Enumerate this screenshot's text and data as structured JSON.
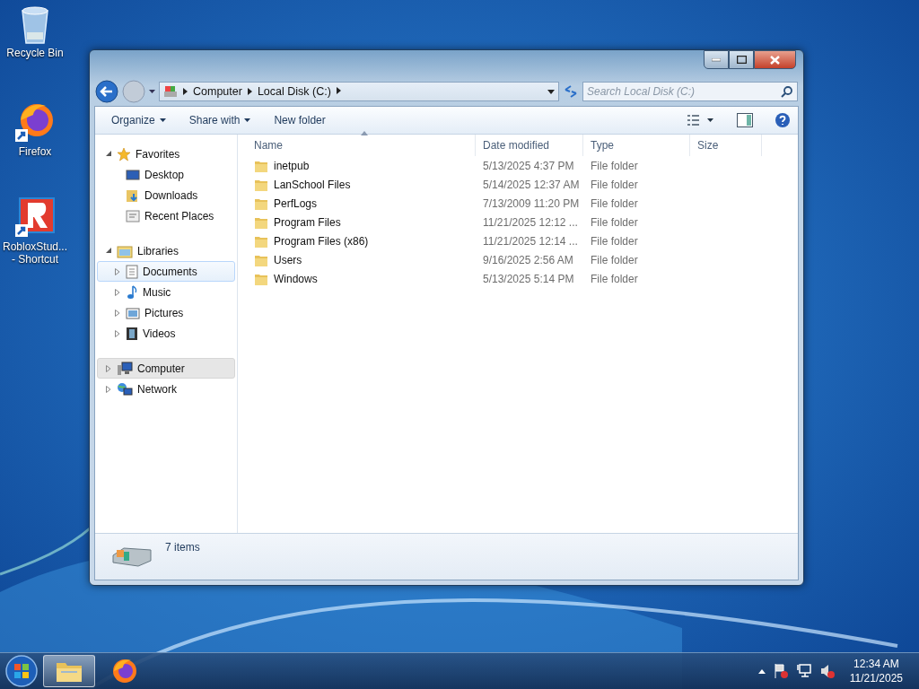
{
  "desktop_icons": [
    {
      "kind": "recycle",
      "label": "Recycle Bin"
    },
    {
      "kind": "firefox",
      "label": "Firefox"
    },
    {
      "kind": "roblox",
      "label": "RobloxStud...\n- Shortcut"
    }
  ],
  "window": {
    "address": [
      "Computer",
      "Local Disk (C:)"
    ],
    "search": {
      "placeholder": "Search Local Disk (C:)"
    },
    "toolbar": [
      "Organize",
      "Share with",
      "New folder"
    ],
    "nav": [
      {
        "label": "Favorites",
        "kind": "star",
        "expanded": true,
        "selected": false,
        "hover": false,
        "children": [
          {
            "label": "Desktop",
            "kind": "desktop",
            "selected": false,
            "hover": false
          },
          {
            "label": "Downloads",
            "kind": "downloads",
            "selected": false,
            "hover": false
          },
          {
            "label": "Recent Places",
            "kind": "recent",
            "selected": false,
            "hover": false
          }
        ]
      },
      {
        "label": "Libraries",
        "kind": "library",
        "expanded": true,
        "selected": false,
        "hover": false,
        "children": [
          {
            "label": "Documents",
            "kind": "documents",
            "expanded": false,
            "selected": false,
            "hover": true
          },
          {
            "label": "Music",
            "kind": "music",
            "expanded": false,
            "selected": false,
            "hover": false
          },
          {
            "label": "Pictures",
            "kind": "pictures",
            "expanded": false,
            "selected": false,
            "hover": false
          },
          {
            "label": "Videos",
            "kind": "videos",
            "expanded": false,
            "selected": false,
            "hover": false
          }
        ]
      },
      {
        "label": "Computer",
        "kind": "computer",
        "expanded": false,
        "selected": true,
        "hover": false
      },
      {
        "label": "Network",
        "kind": "network",
        "expanded": false,
        "selected": false,
        "hover": false
      }
    ],
    "table": {
      "columns": [
        {
          "label": "Name",
          "sorted": true
        },
        {
          "label": "Date modified",
          "sorted": false
        },
        {
          "label": "Type",
          "sorted": false
        },
        {
          "label": "Size",
          "sorted": false
        }
      ],
      "rows": [
        [
          "inetpub",
          "5/13/2025 4:37 PM",
          "File folder"
        ],
        [
          "LanSchool Files",
          "5/14/2025 12:37 AM",
          "File folder"
        ],
        [
          "PerfLogs",
          "7/13/2009 11:20 PM",
          "File folder"
        ],
        [
          "Program Files",
          "11/21/2025 12:12 ...",
          "File folder"
        ],
        [
          "Program Files (x86)",
          "11/21/2025 12:14 ...",
          "File folder"
        ],
        [
          "Users",
          "9/16/2025 2:56 AM",
          "File folder"
        ],
        [
          "Windows",
          "5/13/2025 5:14 PM",
          "File folder"
        ]
      ]
    },
    "status_bar": "7 items"
  },
  "taskbar": {
    "buttons": [
      {
        "kind": "explorer",
        "selected": true
      },
      {
        "kind": "firefox",
        "selected": false
      }
    ],
    "clock": {
      "time": "12:34 AM",
      "date": "11/21/2025"
    }
  }
}
